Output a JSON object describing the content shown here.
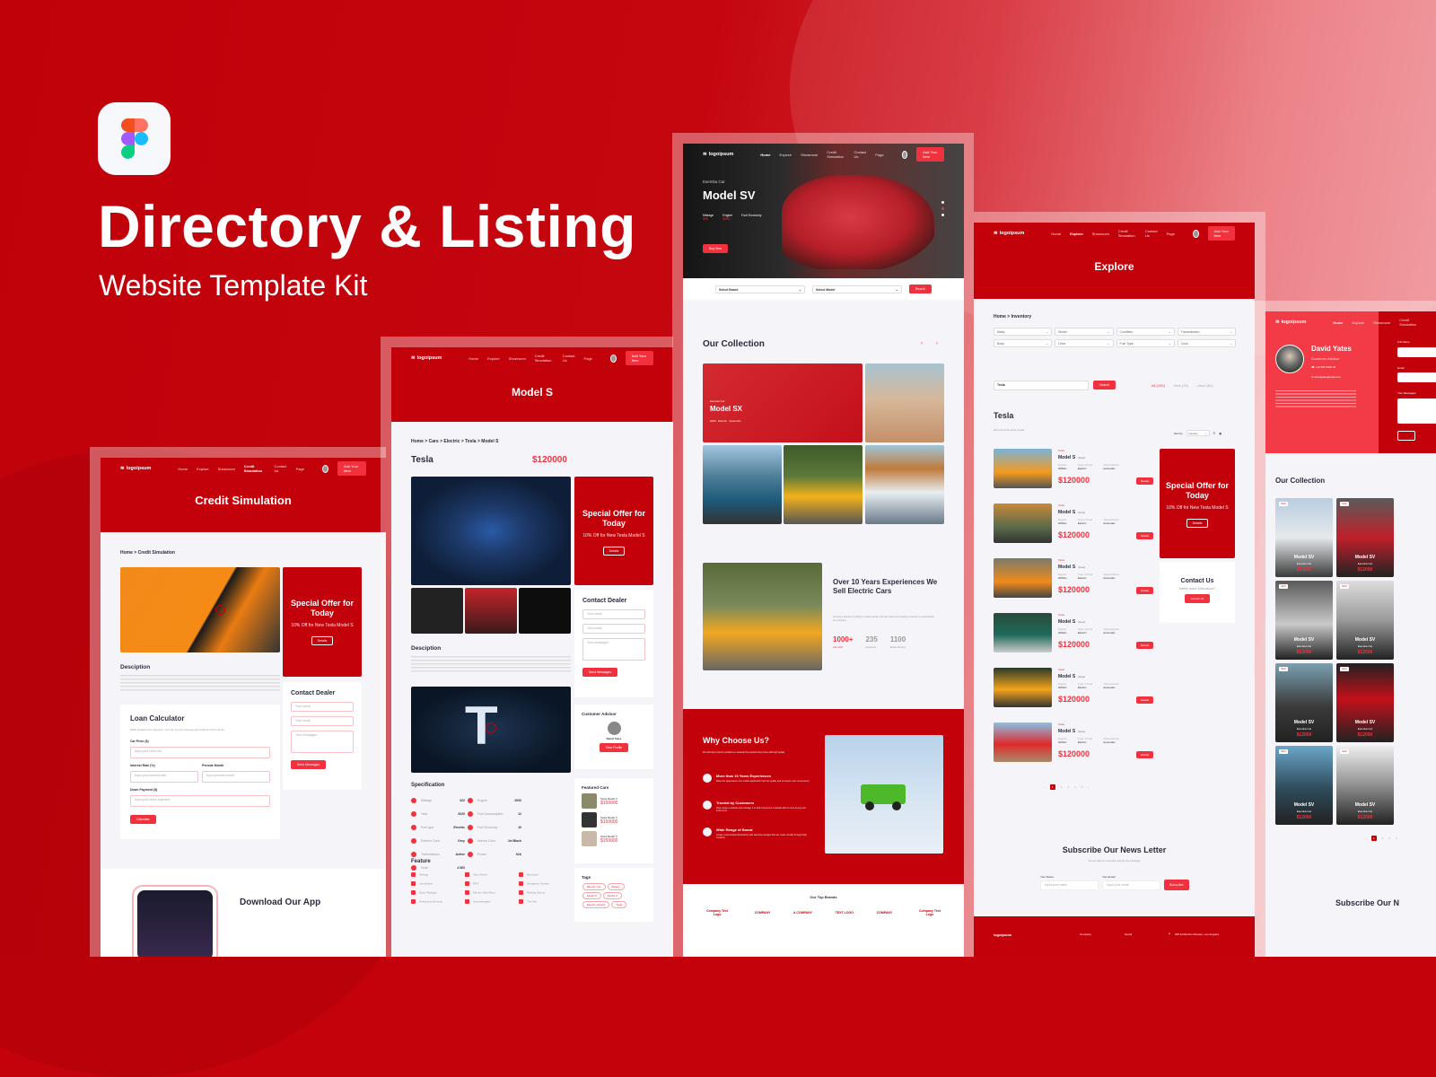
{
  "hero": {
    "title": "Directory & Listing",
    "subtitle": "Website Template Kit",
    "app_icon": "figma-icon"
  },
  "nav": {
    "logo": "logoipsum",
    "links": [
      "Home",
      "Explore",
      "Showroom",
      "Credit Simulation",
      "Contact Us",
      "Page"
    ],
    "cta": "Add Your Item"
  },
  "credit_page": {
    "title": "Credit Simulation",
    "breadcrumb": "Home > Credit Simulation",
    "offer": {
      "title": "Special Offer for Today",
      "text": "10% Off for New Tesla Model S",
      "button": "Details"
    },
    "description_title": "Desciption",
    "contact": {
      "title": "Contact Dealer",
      "name_ph": "Your name",
      "email_ph": "Your email",
      "msg_ph": "Your messages",
      "button": "Send Messages"
    },
    "loan": {
      "title": "Loan Calculator",
      "subtitle": "What created new resource. You can try our resource and explore how it works",
      "car_price_label": "Car Price ($)",
      "car_price_ph": "Input your price car",
      "rate_label": "Interest Rate (%)",
      "rate_ph": "Input your interest rate",
      "period_label": "Periode Month",
      "period_ph": "Input periode month",
      "down_label": "Down Payment ($)",
      "down_ph": "Input your down payment",
      "button": "Calculate"
    },
    "app_title": "Download Our App"
  },
  "model_page": {
    "title": "Model S",
    "breadcrumb": "Home > Cars > Electric > Tesla > Model S",
    "brand": "Tesla",
    "price": "$120000",
    "offer": {
      "title": "Special Offer for Today",
      "text": "10% Off for New Tesla Model S",
      "button": "Details"
    },
    "contact": {
      "title": "Contact Dealer",
      "name_ph": "Your name",
      "email_ph": "Your email",
      "msg_ph": "Your messages",
      "button": "Send Messages"
    },
    "description_title": "Desciption",
    "advisor": {
      "title": "Customer Advisor",
      "name": "David Yates",
      "button": "View Profile"
    },
    "spec_title": "Specification",
    "specs": [
      {
        "k": "Mileage",
        "v": "322"
      },
      {
        "k": "Engine",
        "v": "2000"
      },
      {
        "k": "Year",
        "v": "2020"
      },
      {
        "k": "Fuel Consumption",
        "v": "12"
      },
      {
        "k": "Fuel type",
        "v": "Electric"
      },
      {
        "k": "Fuel Economy",
        "v": "10"
      },
      {
        "k": "Exterior Color",
        "v": "Grey"
      },
      {
        "k": "Interior Color",
        "v": "Jet Black"
      },
      {
        "k": "Transmission",
        "v": "Active"
      },
      {
        "k": "Power",
        "v": "N/A"
      },
      {
        "k": "Drive",
        "v": "4 WD"
      }
    ],
    "featured_title": "Featured Cars",
    "featured": [
      {
        "name": "Tesla Model X",
        "price": "$150000"
      },
      {
        "name": "Tesla Model X",
        "price": "$150000"
      },
      {
        "name": "Tesla Model X",
        "price": "$150000"
      }
    ],
    "feature_title": "Feature",
    "features": [
      "Airbags",
      "Alloy Wheel",
      "Bluetooth",
      "Immobilizer",
      "MP3",
      "Navigation System",
      "Sport Package",
      "Electric Side Mirror",
      "Parking Sensor",
      "Streaming Services",
      "Superchargers",
      "The Key"
    ],
    "tags_title": "Tags",
    "tags": [
      "Electric Car",
      "Battery",
      "Model S",
      "Model X",
      "Electric Vehicle",
      "Tesla"
    ]
  },
  "home_page": {
    "hero_sub": "Esemka Car",
    "hero_title": "Model SV",
    "hero_stats": [
      {
        "k": "Mileage",
        "v": "555"
      },
      {
        "k": "Engine",
        "v": "3000"
      },
      {
        "k": "Fuel Economy",
        "v": ""
      }
    ],
    "buy": "Buy Now",
    "select_brand": "Select Brand",
    "select_model": "Select Model",
    "search": "Search",
    "collection_title": "Our Collection",
    "featured_car": {
      "sub": "Esemka Car",
      "name": "Model SX",
      "meta": "2000   Electric   Automatic"
    },
    "about": {
      "title": "Over 10 Years Experiences We Sell Electric Cars",
      "text": "Develop a website by finding a product identity that has value and branding to become a characteristic of a company.",
      "stats": [
        {
          "v": "1000+",
          "k": "Cars Sold"
        },
        {
          "v": "235",
          "k": "Customers"
        },
        {
          "v": "1100",
          "k": "Dealer Reviews"
        }
      ]
    },
    "why": {
      "title": "Why Choose Us?",
      "text": "We will help a client's problems to develop the products they have with high quality",
      "items": [
        {
          "t": "More than 10 Years Experiences",
          "d": "Make the appearance of a mobile application that has quality and increases user convenience"
        },
        {
          "t": "Trusted by Customers",
          "d": "Help create a website and redesign it so that it becomes a website that is more trendy and looks fresh"
        },
        {
          "t": "Wide Range of Brand",
          "d": "Create customizable illustrations with attractive designs that are made visually through high creativity"
        }
      ]
    },
    "brands_title": "Our Top Brands",
    "brands": [
      "Company Text Logo",
      "COMPANY",
      "A COMPANY",
      "TEXT LOGO",
      "COMPANY",
      "Company Text Logo"
    ]
  },
  "explore_page": {
    "title": "Explore",
    "breadcrumb": "Home > Inventory",
    "filters": [
      "Make",
      "Model",
      "Condition",
      "Transmission",
      "Body",
      "Drive",
      "Fule Type",
      "Color"
    ],
    "search_value": "Tesla",
    "search_btn": "Search",
    "tabs": [
      "All (100)",
      "New (40)",
      "Used (60)"
    ],
    "results_title": "Tesla",
    "results_sub": "We've found 20 results of tesla",
    "sort_label": "Sort by",
    "sort_value": "Newest",
    "listings": [
      {
        "brand": "Tesla",
        "name": "Model S",
        "cond": "(New)",
        "engine": "2000cc",
        "fuel": "Electric",
        "trans": "Automatic",
        "price": "$120000",
        "btn": "Details"
      },
      {
        "brand": "Tesla",
        "name": "Model S",
        "cond": "(New)",
        "engine": "2000cc",
        "fuel": "Electric",
        "trans": "Automatic",
        "price": "$120000",
        "btn": "Details"
      },
      {
        "brand": "Tesla",
        "name": "Model S",
        "cond": "(New)",
        "engine": "2000cc",
        "fuel": "Electric",
        "trans": "Automatic",
        "price": "$120000",
        "btn": "Details"
      },
      {
        "brand": "Tesla",
        "name": "Model S",
        "cond": "(New)",
        "engine": "2000cc",
        "fuel": "Electric",
        "trans": "Automatic",
        "price": "$120000",
        "btn": "Details"
      },
      {
        "brand": "Tesla",
        "name": "Model S",
        "cond": "(New)",
        "engine": "2000cc",
        "fuel": "Electric",
        "trans": "Automatic",
        "price": "$120000",
        "btn": "Details"
      },
      {
        "brand": "Tesla",
        "name": "Model S",
        "cond": "(New)",
        "engine": "2000cc",
        "fuel": "Electric",
        "trans": "Automatic",
        "price": "$120000",
        "btn": "Details"
      }
    ],
    "spec_labels": [
      "Engine",
      "Type of Fuel",
      "Transmission"
    ],
    "offer": {
      "title": "Special Offer for Today",
      "text": "10% Off for New Tesla Model S",
      "button": "Details"
    },
    "contact": {
      "title": "Contact Us",
      "text": "Need more Discusion?",
      "button": "Contact Us"
    },
    "pages": [
      "1",
      "2",
      "3",
      "4",
      "5"
    ],
    "newsletter": {
      "title": "Subscribe Our News Letter",
      "text": "You can read our news letter and get free knowledge",
      "name_label": "Your Name",
      "name_ph": "Input your name",
      "email_label": "Your Email",
      "email_ph": "Input your email",
      "button": "Subscribe"
    },
    "footer": {
      "company": "Company",
      "social": "Social",
      "address": "205 El Rancho Monaco, Los Angeles"
    }
  },
  "advisor_page": {
    "name": "David Yates",
    "role": "Customer Advisor",
    "phone": "+12 905 3345 23",
    "email": "davidyates@mail.com",
    "form_labels": [
      "Full Name",
      "Email",
      "Your Messages"
    ],
    "collection_title": "Our Collection",
    "cards": [
      {
        "name": "Model SV",
        "sub": "Esemka Car",
        "price": "$12000",
        "badge": "NEW"
      },
      {
        "name": "Model SV",
        "sub": "Esemka Car",
        "price": "$12000",
        "badge": "NEW"
      },
      {
        "name": "Model SV",
        "sub": "Esemka Car",
        "price": "$12000",
        "badge": "NEW"
      },
      {
        "name": "Model SV",
        "sub": "Esemka Car",
        "price": "$12000",
        "badge": "NEW"
      },
      {
        "name": "Model SV",
        "sub": "Esemka Car",
        "price": "$12000",
        "badge": "NEW"
      },
      {
        "name": "Model SV",
        "sub": "Esemka Car",
        "price": "$12000",
        "badge": "NEW"
      },
      {
        "name": "Model SV",
        "sub": "Esemka Car",
        "price": "$12000",
        "badge": "NEW"
      },
      {
        "name": "Model SV",
        "sub": "Esemka Car",
        "price": "$12000",
        "badge": "NEW"
      }
    ],
    "pages": [
      "1",
      "2",
      "3",
      "4"
    ],
    "newsletter_title": "Subscribe Our N"
  }
}
